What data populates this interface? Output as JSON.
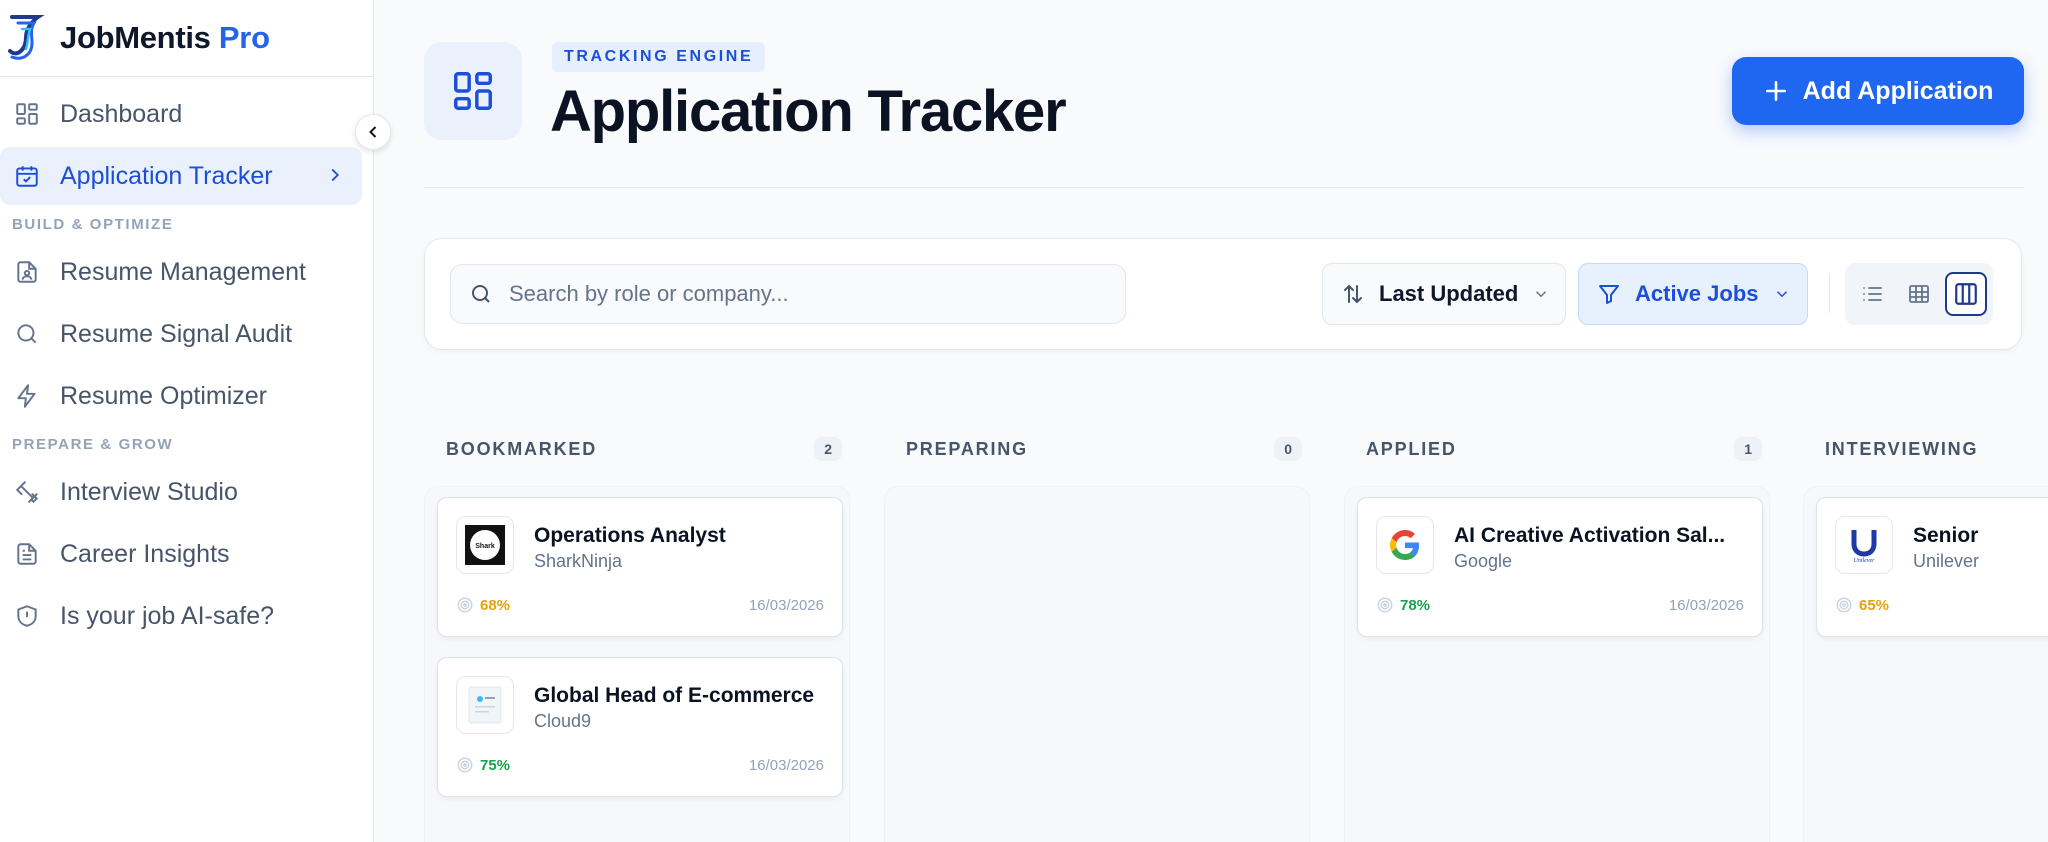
{
  "brand": {
    "name": "JobMentis",
    "suffix": "Pro"
  },
  "sidebar": {
    "items": [
      {
        "label": "Dashboard",
        "icon": "dashboard-icon"
      },
      {
        "label": "Application Tracker",
        "icon": "calendar-check-icon",
        "active": true
      }
    ],
    "section_build": "BUILD & OPTIMIZE",
    "build_items": [
      {
        "label": "Resume Management",
        "icon": "file-user-icon"
      },
      {
        "label": "Resume Signal Audit",
        "icon": "search-icon"
      },
      {
        "label": "Resume Optimizer",
        "icon": "lightning-icon"
      }
    ],
    "section_prepare": "PREPARE & GROW",
    "prepare_items": [
      {
        "label": "Interview Studio",
        "icon": "dumbbell-icon"
      },
      {
        "label": "Career Insights",
        "icon": "document-icon"
      },
      {
        "label": "Is your job AI-safe?",
        "icon": "shield-icon"
      }
    ]
  },
  "header": {
    "eyebrow": "TRACKING ENGINE",
    "title": "Application Tracker",
    "add_label": "Add Application"
  },
  "toolbar": {
    "search_placeholder": "Search by role or company...",
    "sort_label": "Last Updated",
    "filter_label": "Active Jobs"
  },
  "colors": {
    "accent": "#1f66f0",
    "score_amber": "#e6a10e",
    "score_green": "#16a34a"
  },
  "columns": [
    {
      "title": "BOOKMARKED",
      "count": "2",
      "cards": [
        {
          "role": "Operations Analyst",
          "company": "SharkNinja",
          "score": "68%",
          "score_tone": "amber",
          "date": "16/03/2026",
          "logo": "sharkninja-logo"
        },
        {
          "role": "Global Head of E-commerce",
          "company": "Cloud9",
          "score": "75%",
          "score_tone": "green",
          "date": "16/03/2026",
          "logo": "cloud9-logo"
        }
      ]
    },
    {
      "title": "PREPARING",
      "count": "0",
      "cards": []
    },
    {
      "title": "APPLIED",
      "count": "1",
      "cards": [
        {
          "role": "AI Creative Activation Sal...",
          "company": "Google",
          "score": "78%",
          "score_tone": "green",
          "date": "16/03/2026",
          "logo": "google-logo"
        }
      ]
    },
    {
      "title": "INTERVIEWING",
      "count": "",
      "cards": [
        {
          "role": "Senior",
          "company": "Unilever",
          "score": "65%",
          "score_tone": "amber",
          "date": "",
          "logo": "unilever-logo"
        }
      ]
    }
  ]
}
